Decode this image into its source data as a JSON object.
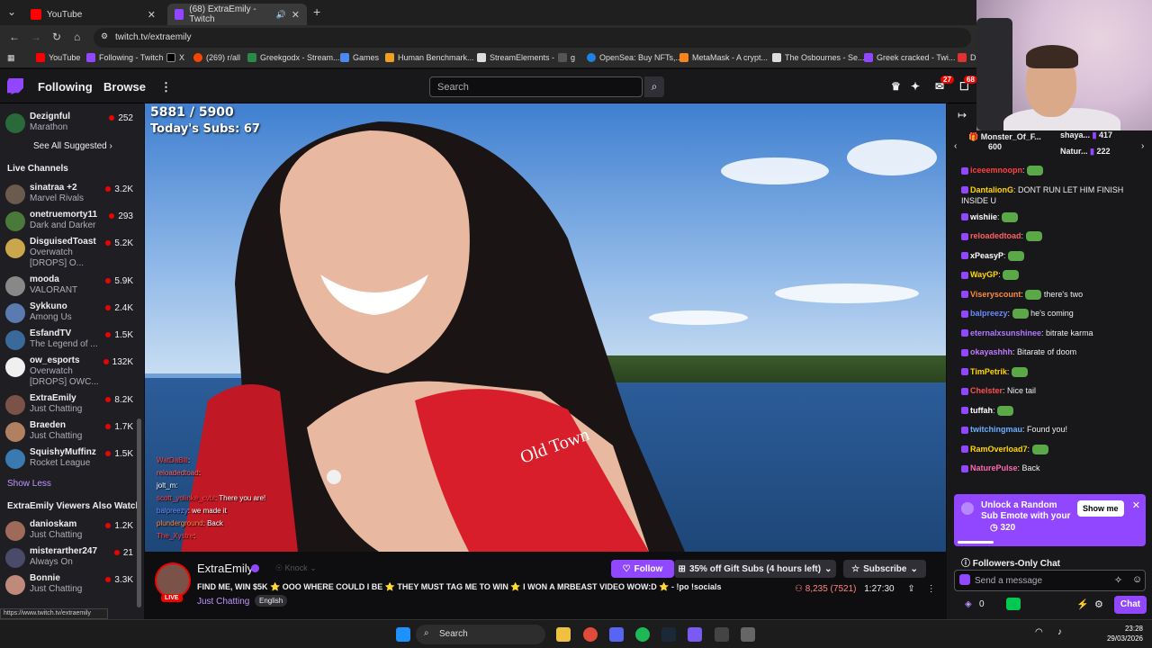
{
  "browser": {
    "tabs": [
      {
        "title": "YouTube",
        "color": "#ff0000"
      },
      {
        "title": "(68) ExtraEmily - Twitch",
        "color": "#9147ff"
      }
    ],
    "url": "twitch.tv/extraemily",
    "bookmarks": [
      "YouTube",
      "Following - Twitch",
      "X",
      "(269) r/all",
      "Greekgodx - Stream...",
      "Games",
      "Human Benchmark...",
      "StreamElements -",
      "g",
      "OpenSea: Buy NFTs,...",
      "MetaMask - A crypt...",
      "The Osbournes - Se...",
      "Greek cracked - Twi...",
      "DZ"
    ],
    "status_link": "https://www.twitch.tv/extraemily"
  },
  "nav": {
    "following": "Following",
    "browse": "Browse",
    "more": "⋮",
    "search_placeholder": "Search",
    "notif_count": "27",
    "whisper_count": "68"
  },
  "sidebar": {
    "top_channel": {
      "name": "Dezignful",
      "game": "Marathon",
      "viewers": "252"
    },
    "see_all": "See All Suggested",
    "live_header": "Live Channels",
    "channels": [
      {
        "name": "sinatraa +2",
        "game": "Marvel Rivals",
        "viewers": "3.2K",
        "color": "#6b5a4e"
      },
      {
        "name": "onetruemorty11",
        "game": "Dark and Darker",
        "viewers": "293",
        "color": "#4a7a3a"
      },
      {
        "name": "DisguisedToast",
        "game": "Overwatch",
        "extra": "[DROPS] O...",
        "viewers": "5.2K",
        "color": "#c9a74a"
      },
      {
        "name": "mooda",
        "game": "VALORANT",
        "viewers": "5.9K",
        "color": "#888"
      },
      {
        "name": "Sykkuno",
        "game": "Among Us",
        "viewers": "2.4K",
        "color": "#5a7ab0"
      },
      {
        "name": "EsfandTV",
        "game": "The Legend of ...",
        "viewers": "1.5K",
        "color": "#3a6a9a"
      },
      {
        "name": "ow_esports",
        "game": "Overwatch",
        "extra": "[DROPS] OWC...",
        "viewers": "132K",
        "color": "#f0f0f0"
      },
      {
        "name": "ExtraEmily",
        "game": "Just Chatting",
        "viewers": "8.2K",
        "color": "#7a5248"
      },
      {
        "name": "Braeden",
        "game": "Just Chatting",
        "viewers": "1.7K",
        "color": "#b08060"
      },
      {
        "name": "SquishyMuffinz",
        "game": "Rocket League",
        "viewers": "1.5K",
        "color": "#3a7ab0"
      }
    ],
    "show_less": "Show Less",
    "also_header": "ExtraEmily Viewers Also Watch",
    "also": [
      {
        "name": "danioskam",
        "game": "Just Chatting",
        "viewers": "1.2K",
        "color": "#a06a5a"
      },
      {
        "name": "misterarther247",
        "game": "Always On",
        "viewers": "21",
        "color": "#4a4a6a"
      },
      {
        "name": "Bonnie",
        "game": "Just Chatting",
        "viewers": "3.3K",
        "color": "#c08a7a"
      }
    ]
  },
  "video": {
    "sub_goal": "5881 / 5900",
    "todays_subs": "Today's Subs: 67",
    "overlay_chat": [
      {
        "user": "WatDaBill",
        "text": "",
        "color": "#ff4040"
      },
      {
        "user": "reloadedtoad",
        "text": "",
        "color": "#ff6060"
      },
      {
        "user": "jolt_m",
        "text": "",
        "color": "#ffffff"
      },
      {
        "user": "scott_yolinke_cvbl",
        "text": "There you are!",
        "color": "#ff4040"
      },
      {
        "user": "balpreezy",
        "text": "we made it",
        "color": "#6a8aff"
      },
      {
        "user": "plunderground",
        "text": "Back",
        "color": "#ff8a40"
      },
      {
        "user": "The_Xystre",
        "text": "",
        "color": "#ff4040"
      }
    ]
  },
  "stream": {
    "channel": "ExtraEmily",
    "knock": "Knock",
    "live": "LIVE",
    "title": "FIND ME, WIN $5K ⭐ OOO WHERE COULD I BE ⭐ THEY MUST TAG ME TO WIN ⭐ I WON A MRBEAST VIDEO WOW:D ⭐ - !po !socials",
    "category": "Just Chatting",
    "tag": "English",
    "follow": "Follow",
    "gift": "35% off Gift Subs (4 hours left)",
    "subscribe": "Subscribe",
    "viewers": "8,235 (7521)",
    "uptime": "1:27:30"
  },
  "chat": {
    "gifters": [
      {
        "name": "Monster_Of_F...",
        "amount": "600"
      },
      {
        "name": "shaya...",
        "amount": "417"
      },
      {
        "name": "Natur...",
        "amount": "222"
      }
    ],
    "messages": [
      {
        "user": "iceeemnoopn",
        "text": "",
        "color": "#ff4040",
        "emote": true
      },
      {
        "user": "DantalionG",
        "text": "DONT RUN LET HIM FINISH INSIDE U",
        "color": "#ffd700",
        "emote": false
      },
      {
        "user": "wishiie",
        "text": "",
        "color": "#ffffff",
        "emote": true
      },
      {
        "user": "reloadedtoad",
        "text": "",
        "color": "#ff6060",
        "emote": true
      },
      {
        "user": "xPeasyP",
        "text": "",
        "color": "#ffffff",
        "emote": true
      },
      {
        "user": "WayGP",
        "text": "",
        "color": "#ffd700",
        "emote": true
      },
      {
        "user": "Viseryscount",
        "text": "there's two",
        "color": "#ff8a40",
        "emote": true
      },
      {
        "user": "balpreezy",
        "text": "he's coming",
        "color": "#6a8aff",
        "emote": true
      },
      {
        "user": "eternalxsunshinee",
        "text": "bitrate karma",
        "color": "#b07aff",
        "emote": false
      },
      {
        "user": "okayashhh",
        "text": "Bitarate of doom",
        "color": "#c07aff",
        "emote": false
      },
      {
        "user": "TimPetrik",
        "text": "",
        "color": "#ffd700",
        "emote": true
      },
      {
        "user": "Chelster",
        "text": "Nice tail",
        "color": "#ff5050",
        "emote": false
      },
      {
        "user": "tuffah",
        "text": "",
        "color": "#ffffff",
        "emote": true
      },
      {
        "user": "twitchingmau",
        "text": "Found you!",
        "color": "#6ab0ff",
        "emote": false
      },
      {
        "user": "RamOverload7",
        "text": "",
        "color": "#ffd700",
        "emote": true
      },
      {
        "user": "NaturePulse",
        "text": "Back",
        "color": "#ff69b4",
        "emote": false
      }
    ],
    "unlock_title": "Unlock a Random Sub Emote with your",
    "unlock_cost": "320",
    "show_me": "Show me",
    "followers_only": "Followers-Only Chat",
    "placeholder": "Send a message",
    "points": "0",
    "chat_button": "Chat"
  },
  "taskbar": {
    "search": "Search",
    "time": "23:28",
    "date": "29/03/2026"
  }
}
